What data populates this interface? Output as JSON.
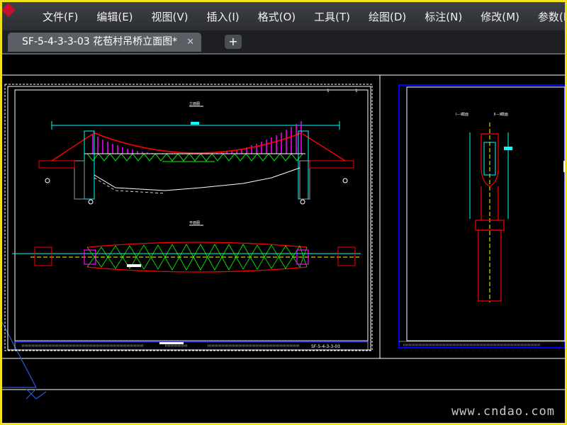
{
  "menubar": {
    "items": [
      {
        "label": "文件(F)"
      },
      {
        "label": "编辑(E)"
      },
      {
        "label": "视图(V)"
      },
      {
        "label": "插入(I)"
      },
      {
        "label": "格式(O)"
      },
      {
        "label": "工具(T)"
      },
      {
        "label": "绘图(D)"
      },
      {
        "label": "标注(N)"
      },
      {
        "label": "修改(M)"
      },
      {
        "label": "参数(P"
      }
    ]
  },
  "tabs": {
    "active": {
      "label": "SF-5-4-3-3-03 花苞村吊桥立面图*",
      "close_glyph": "✕"
    },
    "add_glyph": "+"
  },
  "drawing": {
    "elevation_title": "立面图",
    "plan_title": "平面图",
    "section_titles": [
      "Ⅰ—Ⅰ截面",
      "Ⅱ—Ⅱ截面"
    ],
    "sheet_number": "SF-5-4-3-3-03",
    "page_marks": [
      "1",
      "1"
    ],
    "colors": {
      "background": "#000000",
      "sheet_frame": "#ffffff",
      "inner_frame": "#0000ff",
      "dimension": "#00ffff",
      "cable": "#ff0000",
      "hangers": "#ff00ff",
      "truss": "#00ff00",
      "structure": "#ff0000",
      "centerline": "#ffff00"
    }
  },
  "watermark": "www.cndao.com"
}
